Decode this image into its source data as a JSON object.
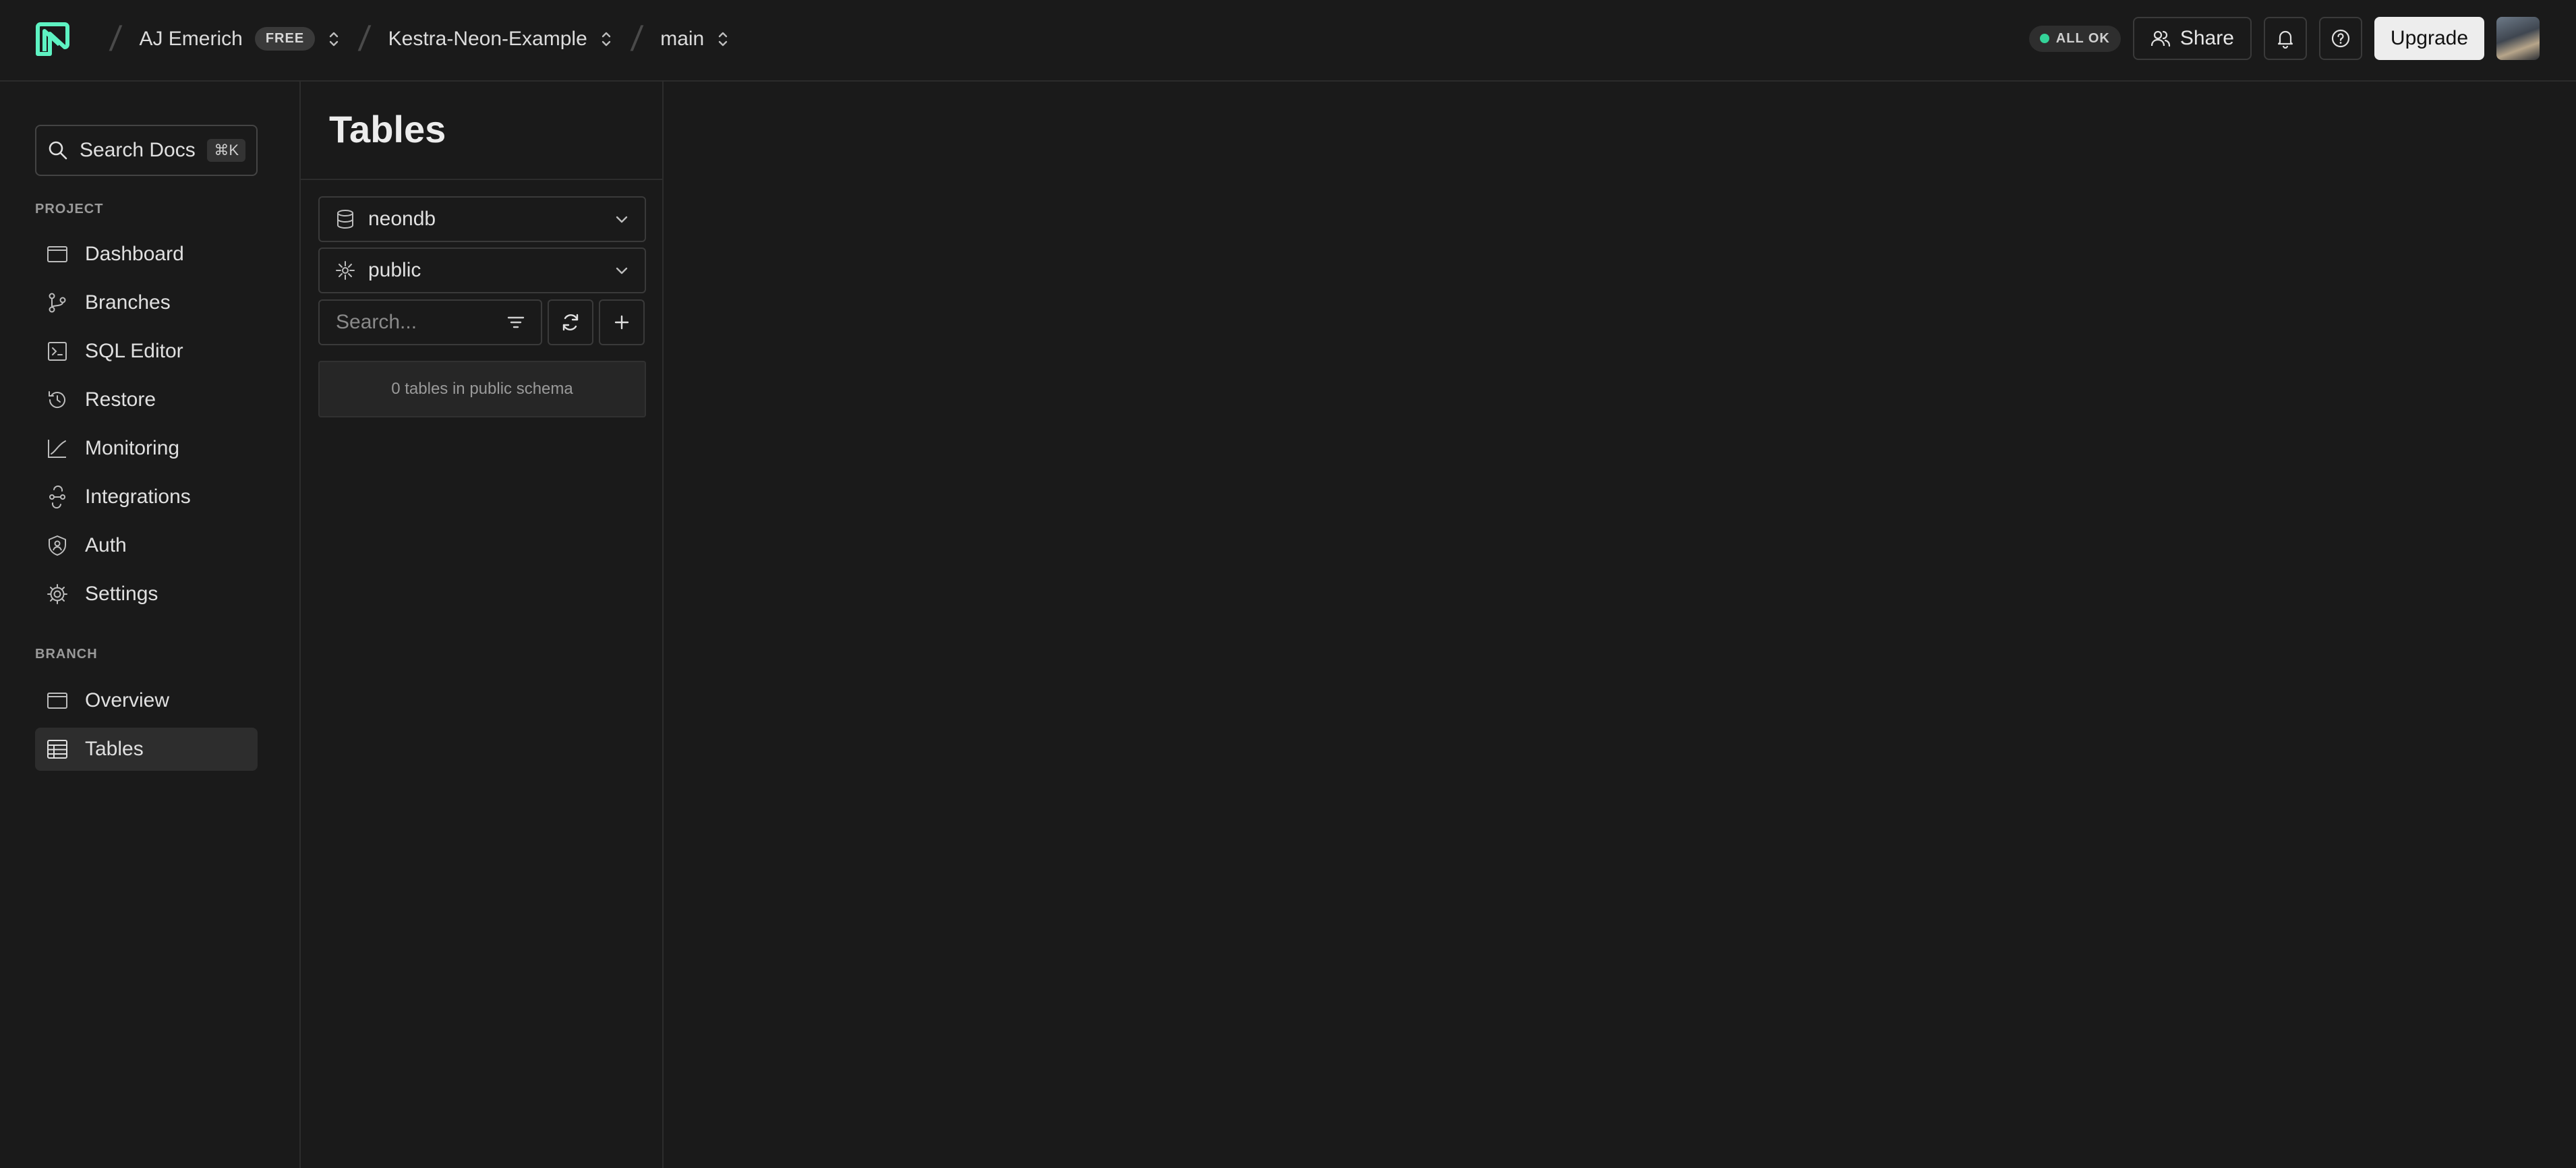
{
  "header": {
    "logo_icon": "neon-logo-icon",
    "org_name": "AJ Emerich",
    "plan_badge": "FREE",
    "project_name": "Kestra-Neon-Example",
    "branch_name": "main",
    "status_text": "ALL OK",
    "status_color": "#34d399",
    "share_label": "Share",
    "upgrade_label": "Upgrade"
  },
  "sidebar": {
    "search_label": "Search Docs",
    "search_shortcut": "⌘K",
    "project_section": "PROJECT",
    "project_items": [
      {
        "label": "Dashboard",
        "icon": "dashboard-icon"
      },
      {
        "label": "Branches",
        "icon": "branches-icon"
      },
      {
        "label": "SQL Editor",
        "icon": "sql-editor-icon"
      },
      {
        "label": "Restore",
        "icon": "restore-icon"
      },
      {
        "label": "Monitoring",
        "icon": "monitoring-icon"
      },
      {
        "label": "Integrations",
        "icon": "integrations-icon"
      },
      {
        "label": "Auth",
        "icon": "auth-icon"
      },
      {
        "label": "Settings",
        "icon": "settings-icon"
      }
    ],
    "branch_section": "BRANCH",
    "branch_items": [
      {
        "label": "Overview",
        "icon": "overview-icon"
      },
      {
        "label": "Tables",
        "icon": "tables-icon",
        "active": true
      }
    ]
  },
  "tables_panel": {
    "title": "Tables",
    "database": "neondb",
    "schema": "public",
    "search_placeholder": "Search...",
    "empty_message": "0 tables in public schema"
  }
}
